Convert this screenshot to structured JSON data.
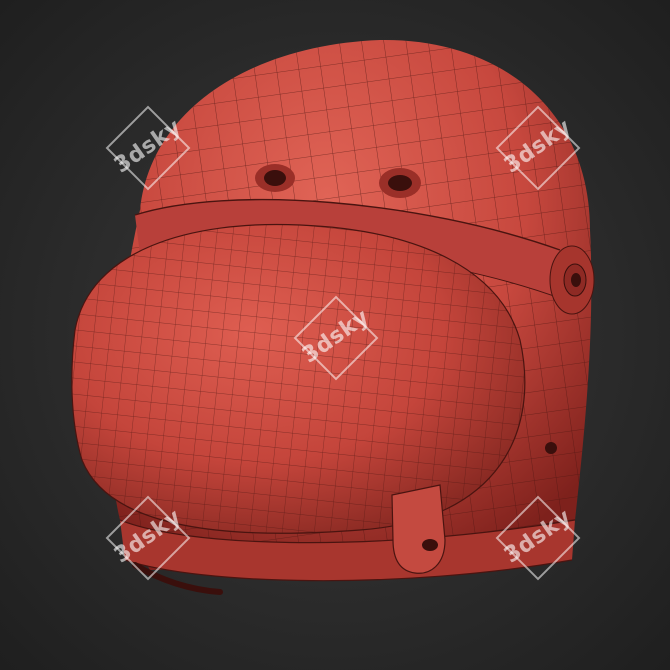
{
  "scene": {
    "subject": "helmet-wireframe-render",
    "colors": {
      "background": "#2b2b2b",
      "shell": "#c7483e",
      "shell_highlight": "#e06456",
      "shell_shadow": "#7e211c",
      "wire": "#4a1410"
    }
  },
  "watermarks": [
    {
      "text": "3dsky"
    },
    {
      "text": "3dsky"
    },
    {
      "text": "3dsky"
    },
    {
      "text": "3dsky"
    },
    {
      "text": "3dsky"
    }
  ]
}
